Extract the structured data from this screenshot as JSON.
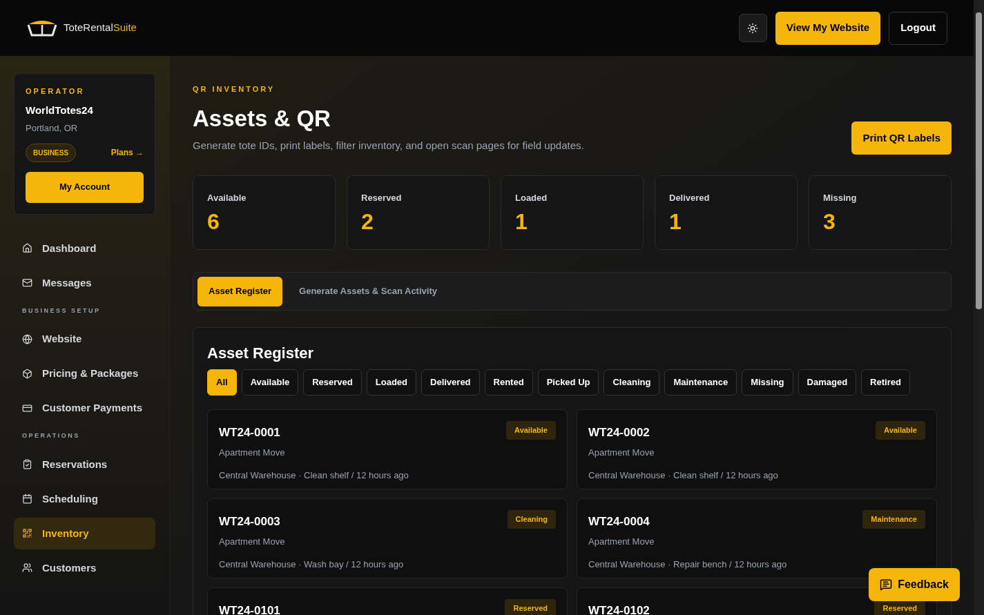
{
  "header": {
    "brand": "ToteRental",
    "brand_accent": "Suite",
    "buttons": [
      {
        "label": "View My Website",
        "kind": "primary"
      },
      {
        "label": "Logout",
        "kind": "outline"
      }
    ]
  },
  "operator": {
    "eyebrow": "OPERATOR",
    "name": "WorldTotes24",
    "location": "Portland, OR",
    "plan": "BUSINESS",
    "plans_link": "Plans →",
    "account_button": "My Account"
  },
  "sidebar": {
    "sections": [
      {
        "items": [
          {
            "label": "Dashboard",
            "selected": false
          },
          {
            "label": "Messages",
            "selected": false
          }
        ]
      },
      {
        "heading": "BUSINESS SETUP",
        "items": [
          {
            "label": "Website",
            "selected": false
          },
          {
            "label": "Pricing & Packages",
            "selected": false
          },
          {
            "label": "Customer Payments",
            "selected": false
          }
        ]
      },
      {
        "heading": "OPERATIONS",
        "items": [
          {
            "label": "Reservations",
            "selected": false
          },
          {
            "label": "Scheduling",
            "selected": false
          },
          {
            "label": "Inventory",
            "selected": true
          },
          {
            "label": "Customers",
            "selected": false
          }
        ]
      }
    ]
  },
  "page": {
    "eyebrow": "QR INVENTORY",
    "title": "Assets & QR",
    "subtitle": "Generate tote IDs, print labels, filter inventory, and open scan pages for field updates.",
    "action": "Print QR Labels"
  },
  "stats": [
    {
      "label": "Available",
      "value": "6"
    },
    {
      "label": "Reserved",
      "value": "2"
    },
    {
      "label": "Loaded",
      "value": "1"
    },
    {
      "label": "Delivered",
      "value": "1"
    },
    {
      "label": "Missing",
      "value": "3"
    }
  ],
  "tabs": [
    {
      "label": "Asset Register",
      "selected": true
    },
    {
      "label": "Generate Assets & Scan Activity",
      "selected": false
    }
  ],
  "register": {
    "title": "Asset Register",
    "filters": [
      {
        "label": "All",
        "selected": true
      },
      {
        "label": "Available",
        "selected": false
      },
      {
        "label": "Reserved",
        "selected": false
      },
      {
        "label": "Loaded",
        "selected": false
      },
      {
        "label": "Delivered",
        "selected": false
      },
      {
        "label": "Rented",
        "selected": false
      },
      {
        "label": "Picked Up",
        "selected": false
      },
      {
        "label": "Cleaning",
        "selected": false
      },
      {
        "label": "Maintenance",
        "selected": false
      },
      {
        "label": "Missing",
        "selected": false
      },
      {
        "label": "Damaged",
        "selected": false
      },
      {
        "label": "Retired",
        "selected": false
      }
    ],
    "assets": [
      {
        "id": "WT24-0001",
        "status": "Available",
        "package": "Apartment Move",
        "location": "Central Warehouse · Clean shelf / 12 hours ago"
      },
      {
        "id": "WT24-0002",
        "status": "Available",
        "package": "Apartment Move",
        "location": "Central Warehouse · Clean shelf / 12 hours ago"
      },
      {
        "id": "WT24-0003",
        "status": "Cleaning",
        "package": "Apartment Move",
        "location": "Central Warehouse · Wash bay / 12 hours ago"
      },
      {
        "id": "WT24-0004",
        "status": "Maintenance",
        "package": "Apartment Move",
        "location": "Central Warehouse · Repair bench / 12 hours ago"
      },
      {
        "id": "WT24-0101",
        "status": "Reserved"
      },
      {
        "id": "WT24-0102",
        "status": "Reserved"
      }
    ]
  },
  "feedback": "Feedback"
}
